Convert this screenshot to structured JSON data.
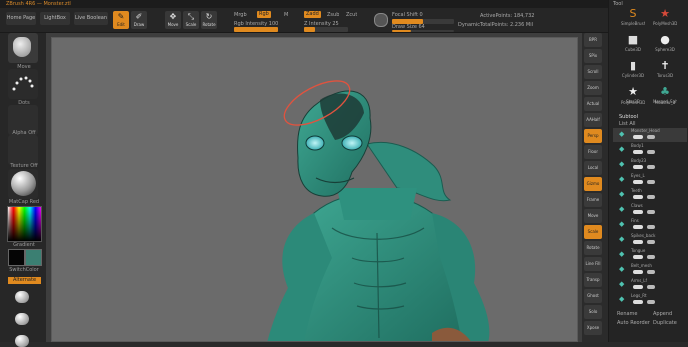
{
  "app": {
    "title": "ZBrush 4R6 — Monster.ztl",
    "accent": "#e08a1f"
  },
  "topshelf": {
    "tabs": [
      "Home Page",
      "LightBox",
      "Live Boolean"
    ],
    "modes": [
      {
        "label": "Edit",
        "glyph": "✎",
        "active": true
      },
      {
        "label": "Draw",
        "glyph": "✐",
        "active": false
      },
      {
        "label": "Move",
        "glyph": "✥",
        "active": false
      },
      {
        "label": "Scale",
        "glyph": "⤡",
        "active": false
      },
      {
        "label": "Rotate",
        "glyph": "↻",
        "active": false
      }
    ],
    "mrgb": "Mrgb",
    "rgb": "Rgb",
    "m": "M",
    "zadd": "Zadd",
    "zsub": "Zsub",
    "zcut": "Zcut",
    "rgb_intensity_label": "Rgb Intensity 100",
    "z_intensity_label": "Z Intensity 25",
    "focal_shift": "Focal Shift 0",
    "draw_size": "Draw Size 64",
    "dynamic": "Dynamic",
    "active_points": "ActivePoints: 184,732",
    "total_points": "TotalPoints: 2.236 Mil"
  },
  "left": {
    "brush": "Move",
    "stroke": "Dots",
    "alpha": "Alpha Off",
    "texture": "Texture Off",
    "material": "MatCap Red",
    "gradient": "Gradient",
    "switch_color": "SwitchColor",
    "alternate": "Alternate"
  },
  "right": {
    "buttons": [
      "BPR",
      "SPix",
      "Scroll",
      "Zoom",
      "Actual",
      "AAHalf",
      "Persp",
      "Floor",
      "Local",
      "Gizmo",
      "Frame",
      "Move",
      "Scale",
      "Rotate",
      "Line Fill",
      "Transp",
      "Ghost",
      "Solo",
      "Xpose"
    ],
    "active": [
      6,
      12,
      13
    ]
  },
  "tray": {
    "header": "Tool",
    "tools": [
      "SimpleBrush",
      "PolyMesh3D",
      "Cube3D",
      "Sphere3D",
      "Cylinder3D",
      "Torus3D",
      "Star3D",
      "Merged_Sphere",
      "PolyMesh3D_1",
      "Monster_1"
    ],
    "subtool_header": "Subtool",
    "list_all": "List All",
    "subtools": [
      "Monster_Head",
      "Body1",
      "Body23",
      "Eyes_L",
      "Teeth",
      "Claws",
      "Fins",
      "Spikes_back",
      "Tongue",
      "Belt_mesh",
      "Arms_Lf",
      "Legs_Rt"
    ],
    "bottom": [
      "Rename",
      "Auto Reorder",
      "Append",
      "Duplicate"
    ]
  }
}
